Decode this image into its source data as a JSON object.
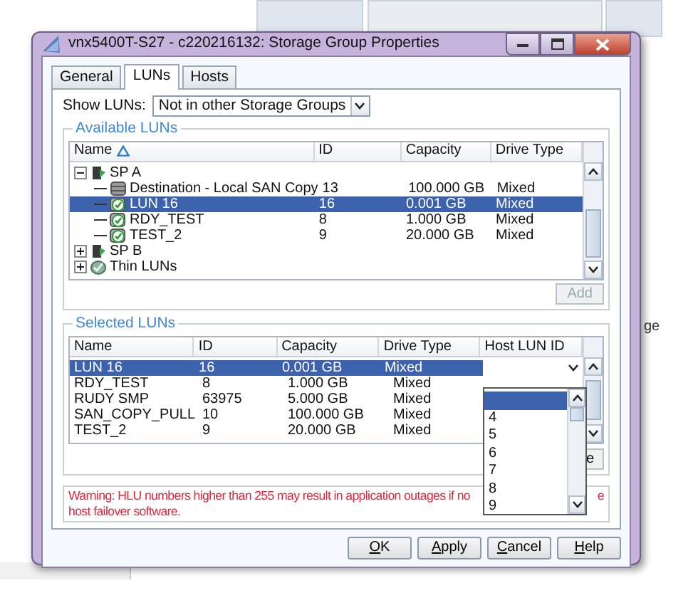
{
  "background_text": "ge",
  "window": {
    "title": "vnx5400T-S27 - c220216132: Storage Group Properties"
  },
  "tabs": [
    {
      "label": "General",
      "selected": false
    },
    {
      "label": "LUNs",
      "selected": true
    },
    {
      "label": "Hosts",
      "selected": false
    }
  ],
  "show_luns": {
    "label": "Show LUNs:",
    "value": "Not in other Storage Groups"
  },
  "available_luns": {
    "title": "Available LUNs",
    "columns": [
      "Name",
      "ID",
      "Capacity",
      "Drive Type"
    ],
    "rows": [
      {
        "name": "SP A",
        "kind": "sp",
        "expanded": true,
        "children": [
          {
            "name": "Destination - Local SAN Copy",
            "kind": "disk",
            "id": "13",
            "capacity": "100.000 GB",
            "drive_type": "Mixed",
            "selected": false
          },
          {
            "name": "LUN 16",
            "kind": "lun",
            "id": "16",
            "capacity": "0.001 GB",
            "drive_type": "Mixed",
            "selected": true
          },
          {
            "name": "RDY_TEST",
            "kind": "lun",
            "id": "8",
            "capacity": "1.000 GB",
            "drive_type": "Mixed",
            "selected": false
          },
          {
            "name": "TEST_2",
            "kind": "lun",
            "id": "9",
            "capacity": "20.000 GB",
            "drive_type": "Mixed",
            "selected": false
          }
        ]
      },
      {
        "name": "SP B",
        "kind": "sp",
        "expanded": false
      },
      {
        "name": "Thin LUNs",
        "kind": "thin",
        "expanded": false
      }
    ],
    "add_button": {
      "label": "Add",
      "disabled": true
    }
  },
  "selected_luns": {
    "title": "Selected LUNs",
    "columns": [
      "Name",
      "ID",
      "Capacity",
      "Drive Type",
      "Host LUN ID"
    ],
    "rows": [
      {
        "name": "LUN 16",
        "id": "16",
        "capacity": "0.001 GB",
        "drive_type": "Mixed",
        "selected": true
      },
      {
        "name": "RDY_TEST",
        "id": "8",
        "capacity": "1.000 GB",
        "drive_type": "Mixed",
        "selected": false
      },
      {
        "name": "RUDY SMP",
        "id": "63975",
        "capacity": "5.000 GB",
        "drive_type": "Mixed",
        "selected": false
      },
      {
        "name": "SAN_COPY_PULL",
        "id": "10",
        "capacity": "100.000 GB",
        "drive_type": "Mixed",
        "selected": false
      },
      {
        "name": "TEST_2",
        "id": "9",
        "capacity": "20.000 GB",
        "drive_type": "Mixed",
        "selected": false
      }
    ],
    "host_lun_options": [
      {
        "selected": true
      },
      {
        "label": "4",
        "selected": false
      },
      {
        "label": "5",
        "selected": false
      },
      {
        "label": "6",
        "selected": false
      },
      {
        "label": "7",
        "selected": false
      },
      {
        "label": "8",
        "selected": false
      },
      {
        "label": "9",
        "selected": false
      }
    ],
    "remove_button": {
      "label": "e"
    }
  },
  "warning": {
    "line_1": "Warning: HLU numbers higher than 255 may result in application outages if no",
    "line_1_end": "e",
    "line_2": "host failover software."
  },
  "buttons": [
    {
      "label": "OK",
      "underline_first": true
    },
    {
      "label": "Apply",
      "underline_first": true
    },
    {
      "label": "Cancel",
      "underline_first": true
    },
    {
      "label": "Help",
      "underline_first": true
    }
  ]
}
